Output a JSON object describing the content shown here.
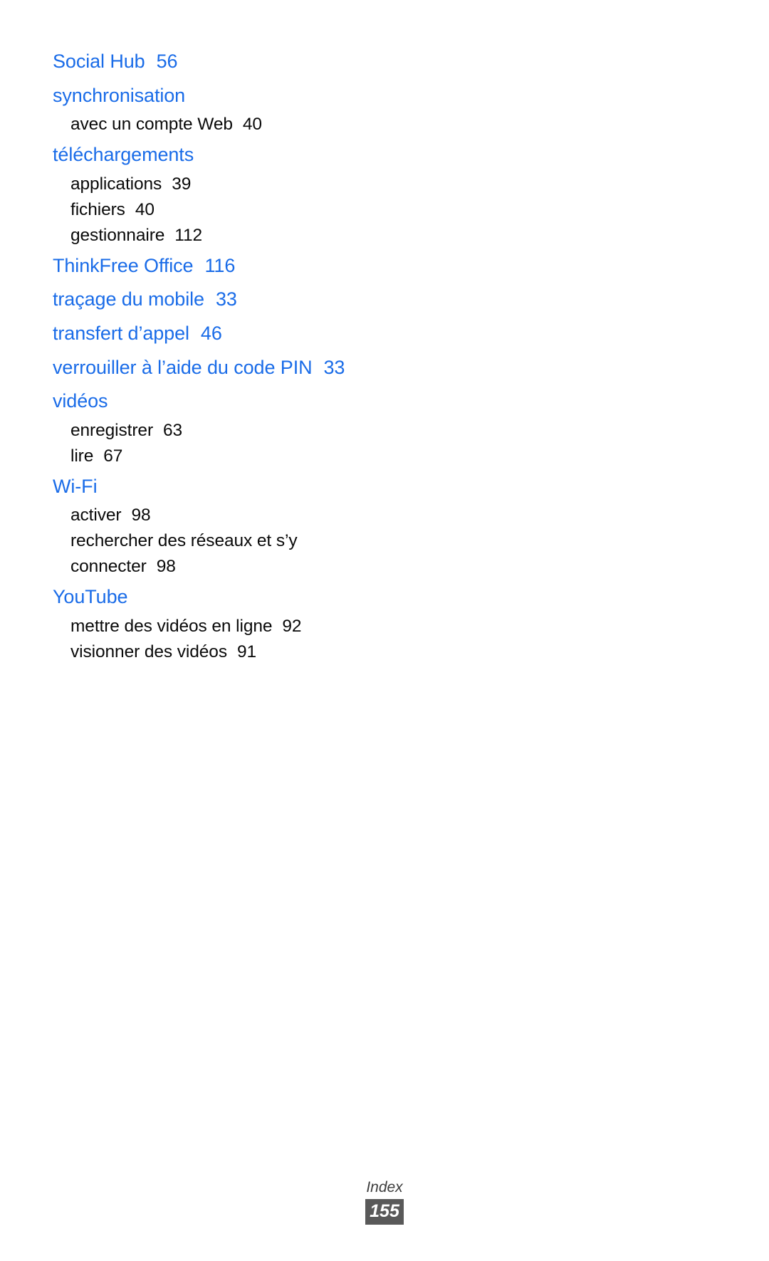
{
  "document": {
    "kind": "index-page",
    "language": "fr",
    "heading_color": "#1a6ce8",
    "body_color": "#0a0a0a",
    "badge_background": "#595959",
    "badge_text_color": "#ffffff"
  },
  "index": {
    "entries": [
      {
        "term": "Social Hub",
        "page": "56",
        "subentries": []
      },
      {
        "term": "synchronisation",
        "page": "",
        "subentries": [
          {
            "term": "avec un compte Web",
            "page": "40"
          }
        ]
      },
      {
        "term": "téléchargements",
        "page": "",
        "subentries": [
          {
            "term": "applications",
            "page": "39"
          },
          {
            "term": "fichiers",
            "page": "40"
          },
          {
            "term": "gestionnaire",
            "page": "112"
          }
        ]
      },
      {
        "term": "ThinkFree Office",
        "page": "116",
        "subentries": []
      },
      {
        "term": "traçage du mobile",
        "page": "33",
        "subentries": []
      },
      {
        "term": "transfert d’appel",
        "page": "46",
        "subentries": []
      },
      {
        "term": "verrouiller à l’aide du code PIN",
        "page": "33",
        "subentries": []
      },
      {
        "term": "vidéos",
        "page": "",
        "subentries": [
          {
            "term": "enregistrer",
            "page": "63"
          },
          {
            "term": "lire",
            "page": "67"
          }
        ]
      },
      {
        "term": "Wi-Fi",
        "page": "",
        "subentries": [
          {
            "term": "activer",
            "page": "98"
          },
          {
            "term": "rechercher des réseaux et s’y connecter",
            "page": "98"
          }
        ]
      },
      {
        "term": "YouTube",
        "page": "",
        "subentries": [
          {
            "term": "mettre des vidéos en ligne",
            "page": "92"
          },
          {
            "term": "visionner des vidéos",
            "page": "91"
          }
        ]
      }
    ]
  },
  "footer": {
    "section_label": "Index",
    "page_number": "155"
  }
}
